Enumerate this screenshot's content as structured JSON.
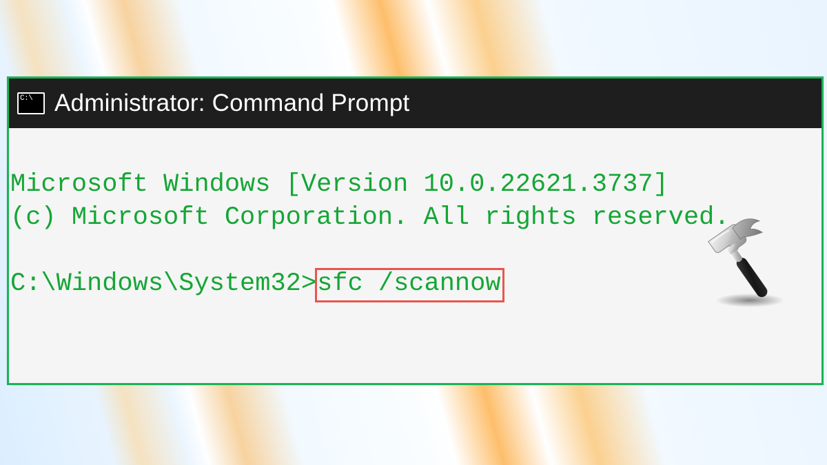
{
  "colors": {
    "window_border": "#19b455",
    "terminal_text": "#15a636",
    "highlight_border": "#e8554d",
    "titlebar_bg": "#1e1e1e"
  },
  "titlebar": {
    "title": "Administrator: Command Prompt"
  },
  "terminal": {
    "line1": "Microsoft Windows [Version 10.0.22621.3737]",
    "line2": "(c) Microsoft Corporation. All rights reserved.",
    "blank": "",
    "prompt": "C:\\Windows\\System32>",
    "command": "sfc /scannow"
  }
}
